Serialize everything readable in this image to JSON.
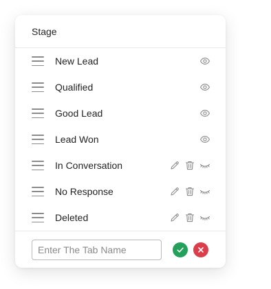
{
  "header": {
    "title": "Stage"
  },
  "stages": [
    {
      "label": "New Lead",
      "editable": false,
      "visible": true
    },
    {
      "label": "Qualified",
      "editable": false,
      "visible": true
    },
    {
      "label": "Good Lead",
      "editable": false,
      "visible": true
    },
    {
      "label": "Lead Won",
      "editable": false,
      "visible": true
    },
    {
      "label": "In Conversation",
      "editable": true,
      "visible": false
    },
    {
      "label": "No Response",
      "editable": true,
      "visible": false
    },
    {
      "label": "Deleted",
      "editable": true,
      "visible": false
    }
  ],
  "footer": {
    "input_value": "",
    "input_placeholder": "Enter The Tab Name",
    "confirm_icon": "check-icon",
    "cancel_icon": "close-icon"
  },
  "colors": {
    "confirm": "#23a05a",
    "cancel": "#dc3d4b",
    "icon": "#8a8a8a"
  }
}
